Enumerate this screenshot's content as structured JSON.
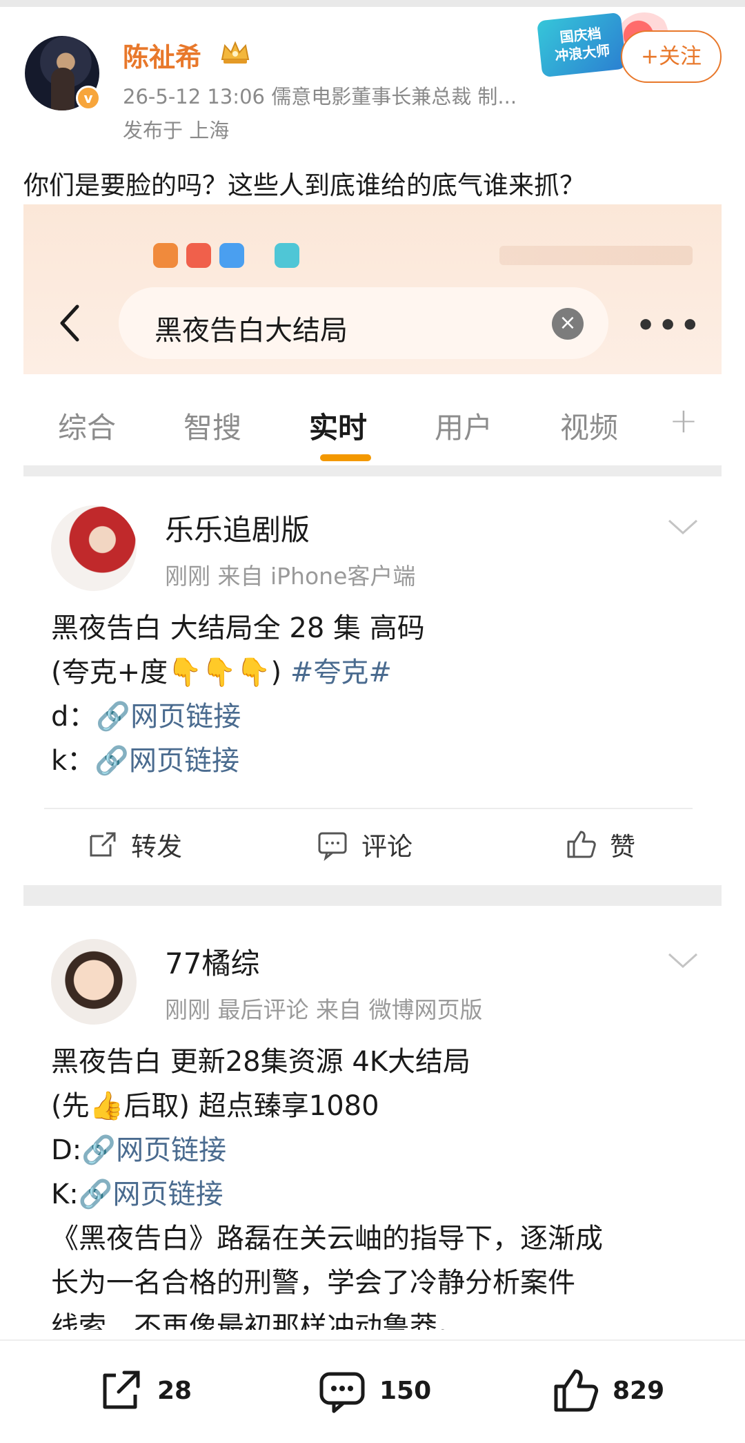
{
  "post": {
    "author_name": "陈祉希",
    "meta": "26-5-12 13:06  儒意电影董事长兼总裁 制...",
    "location": "发布于 上海",
    "follow_label": "+关注",
    "festival_badge": "国庆档\n冲浪大师",
    "text": "你们是要脸的吗？这些人到底谁给的底气谁来抓？"
  },
  "screenshot": {
    "search_query": "黑夜告白大结局",
    "tabs": [
      {
        "label": "综合",
        "active": false
      },
      {
        "label": "智搜",
        "active": false
      },
      {
        "label": "实时",
        "active": true
      },
      {
        "label": "用户",
        "active": false
      },
      {
        "label": "视频",
        "active": false
      }
    ],
    "accent_color": "#f39800",
    "cards": [
      {
        "user": "乐乐追剧版",
        "meta": "刚刚   来自 iPhone客户端",
        "line1": "黑夜告白 大结局全 28 集 高码",
        "line2_prefix": "(夸克+度",
        "line2_emoji": "👇👇👇",
        "line2_suffix": ")",
        "topic": "#夸克#",
        "link_rows": [
          {
            "prefix": "d：",
            "text": "网页链接"
          },
          {
            "prefix": "k：",
            "text": "网页链接"
          }
        ],
        "actions": {
          "repost": "转发",
          "comment": "评论",
          "like": "赞"
        }
      },
      {
        "user": "77橘综",
        "meta": "刚刚 最后评论   来自 微博网页版",
        "line1": "黑夜告白  更新28集资源 4K大结局",
        "line2_prefix": "(先",
        "line2_emoji": "👍",
        "line2_suffix": "后取) 超点臻享1080",
        "link_rows": [
          {
            "prefix": "D:",
            "text": "网页链接"
          },
          {
            "prefix": "K:",
            "text": "网页链接"
          }
        ],
        "desc_lines": [
          "《黑夜告白》路磊在关云岫的指导下，逐渐成",
          "长为一名合格的刑警，学会了冷静分析案件",
          "线索，不再像最初那样冲动鲁莽。"
        ]
      }
    ]
  },
  "bottom_bar": {
    "reposts": "28",
    "comments": "150",
    "likes": "829"
  }
}
